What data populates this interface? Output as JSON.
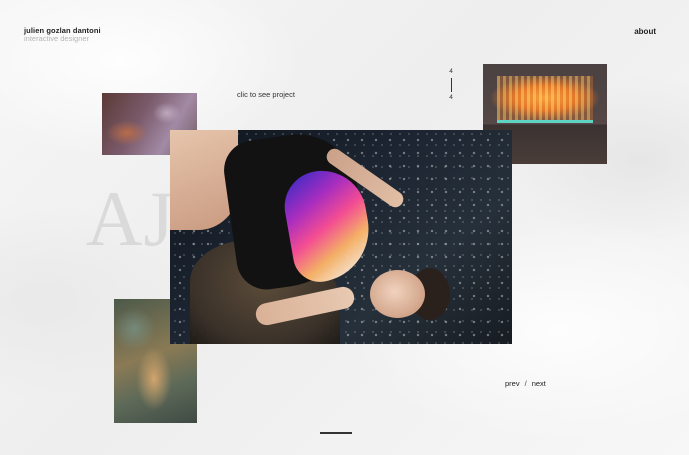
{
  "header": {
    "brand_name": "julien gozlan dantoni",
    "brand_role": "interactive designer",
    "about_label": "about"
  },
  "project": {
    "title": "AJL Photos",
    "cta_label": "clic to see project",
    "counter_current": "4",
    "counter_total": "4"
  },
  "pager": {
    "prev_label": "prev",
    "separator": "/",
    "next_label": "next"
  },
  "thumbnails": [
    {
      "name": "project-thumbnail-top-left"
    },
    {
      "name": "project-thumbnail-top-right"
    },
    {
      "name": "project-thumbnail-bottom-left"
    }
  ],
  "colors": {
    "background": "#f3f3f3",
    "text": "#222222",
    "muted": "#b5b5b5"
  }
}
